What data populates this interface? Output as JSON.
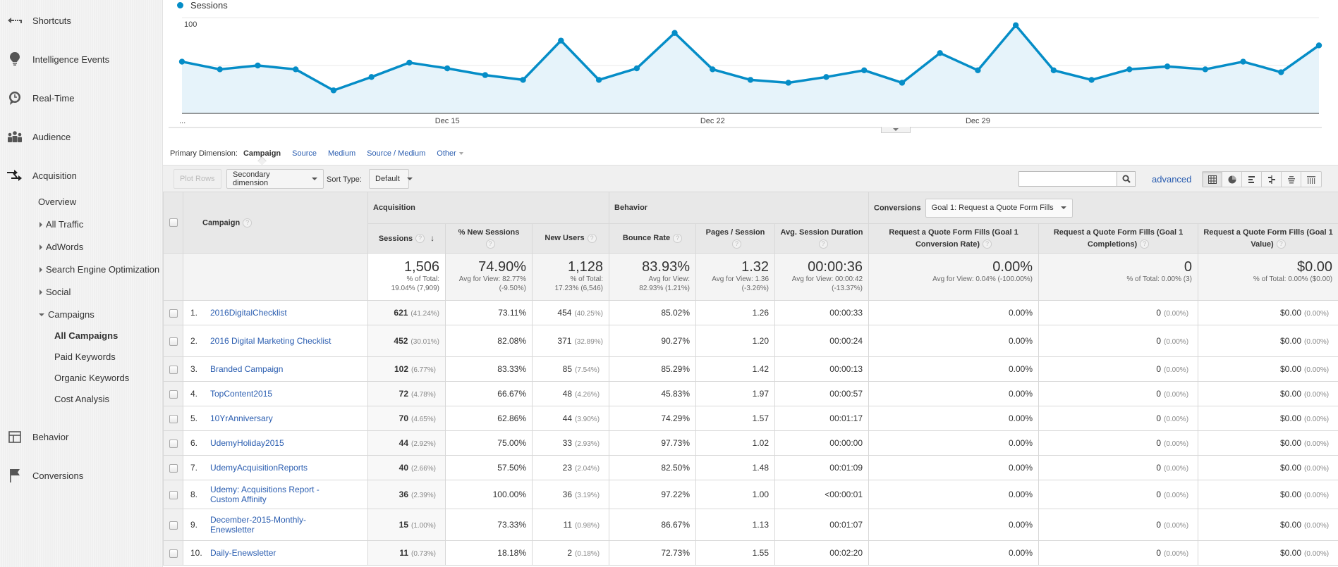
{
  "sidebar": {
    "items": [
      {
        "label": "Shortcuts",
        "icon": "shortcuts-icon"
      },
      {
        "label": "Intelligence Events",
        "icon": "lightbulb-icon"
      },
      {
        "label": "Real-Time",
        "icon": "clock-icon"
      },
      {
        "label": "Audience",
        "icon": "people-icon"
      },
      {
        "label": "Acquisition",
        "icon": "acquisition-arrows-icon"
      },
      {
        "label": "Behavior",
        "icon": "behavior-layout-icon"
      },
      {
        "label": "Conversions",
        "icon": "flag-icon"
      }
    ],
    "acquisition_sub": [
      {
        "label": "Overview"
      },
      {
        "label": "All Traffic",
        "expander": "collapsed"
      },
      {
        "label": "AdWords",
        "expander": "collapsed"
      },
      {
        "label": "Search Engine Optimization",
        "expander": "collapsed"
      },
      {
        "label": "Social",
        "expander": "collapsed"
      },
      {
        "label": "Campaigns",
        "expander": "expanded"
      }
    ],
    "campaigns_sub": [
      {
        "label": "All Campaigns",
        "active": true
      },
      {
        "label": "Paid Keywords"
      },
      {
        "label": "Organic Keywords"
      },
      {
        "label": "Cost Analysis"
      }
    ]
  },
  "chart_data": {
    "type": "area",
    "title": "",
    "series": [
      {
        "name": "Sessions",
        "color": "#058dc7",
        "values": [
          54,
          46,
          50,
          46,
          24,
          38,
          53,
          47,
          40,
          35,
          76,
          35,
          47,
          84,
          46,
          35,
          32,
          38,
          45,
          32,
          63,
          45,
          92,
          45,
          35,
          46,
          49,
          46,
          54,
          43,
          71
        ]
      }
    ],
    "x_tick_labels": [
      {
        "index": 0,
        "label": "..."
      },
      {
        "index": 7,
        "label": "Dec 15"
      },
      {
        "index": 14,
        "label": "Dec 22"
      },
      {
        "index": 21,
        "label": "Dec 29"
      }
    ],
    "y_tick_labels": [
      "100",
      "50"
    ],
    "y_ticks": [
      100,
      50
    ],
    "ylim": [
      0,
      100
    ],
    "grid": true,
    "legend": "top-left",
    "xlabel": "",
    "ylabel": ""
  },
  "primary_dimension": {
    "label": "Primary Dimension:",
    "active": "Campaign",
    "options": [
      "Source",
      "Medium",
      "Source / Medium"
    ],
    "other": "Other"
  },
  "toolbar": {
    "plot_rows": "Plot Rows",
    "secondary_dimension": "Secondary dimension",
    "sort_type_label": "Sort Type:",
    "sort_type_value": "Default",
    "search_value": "",
    "advanced": "advanced"
  },
  "table": {
    "groups": {
      "acquisition": "Acquisition",
      "behavior": "Behavior",
      "conversions": "Conversions",
      "goal_select": "Goal 1: Request a Quote Form Fills"
    },
    "columns": {
      "campaign": "Campaign",
      "sessions": "Sessions",
      "new_sessions": "% New Sessions",
      "new_users": "New Users",
      "bounce_rate": "Bounce Rate",
      "pages_session": "Pages / Session",
      "avg_duration": "Avg. Session Duration",
      "conv_rate": "Request a Quote Form Fills (Goal 1 Conversion Rate)",
      "completions": "Request a Quote Form Fills (Goal 1 Completions)",
      "value": "Request a Quote Form Fills (Goal 1 Value)"
    },
    "totals": {
      "sessions": {
        "value": "1,506",
        "l1": "% of Total:",
        "l2": "19.04% (7,909)"
      },
      "new_sessions": {
        "value": "74.90%",
        "l1": "Avg for View: 82.77%",
        "l2": "(-9.50%)"
      },
      "new_users": {
        "value": "1,128",
        "l1": "% of Total:",
        "l2": "17.23% (6,546)"
      },
      "bounce_rate": {
        "value": "83.93%",
        "l1": "Avg for View:",
        "l2": "82.93% (1.21%)"
      },
      "pages_session": {
        "value": "1.32",
        "l1": "Avg for View: 1.36",
        "l2": "(-3.26%)"
      },
      "avg_duration": {
        "value": "00:00:36",
        "l1": "Avg for View: 00:00:42",
        "l2": "(-13.37%)"
      },
      "conv_rate": {
        "value": "0.00%",
        "l1": "Avg for View: 0.04% (-100.00%)"
      },
      "completions": {
        "value": "0",
        "l1": "% of Total: 0.00% (3)"
      },
      "value": {
        "value": "$0.00",
        "l1": "% of Total: 0.00% ($0.00)"
      }
    },
    "rows": [
      {
        "n": "1.",
        "campaign": "2016DigitalChecklist",
        "sessions": "621",
        "sessions_pct": "(41.24%)",
        "new_sessions": "73.11%",
        "new_users": "454",
        "new_users_pct": "(40.25%)",
        "bounce": "85.02%",
        "pages": "1.26",
        "duration": "00:00:33",
        "conv_rate": "0.00%",
        "completions": "0",
        "completions_pct": "(0.00%)",
        "value": "$0.00",
        "value_pct": "(0.00%)"
      },
      {
        "n": "2.",
        "campaign": "2016 Digital Marketing Checklist",
        "sessions": "452",
        "sessions_pct": "(30.01%)",
        "new_sessions": "82.08%",
        "new_users": "371",
        "new_users_pct": "(32.89%)",
        "bounce": "90.27%",
        "pages": "1.20",
        "duration": "00:00:24",
        "conv_rate": "0.00%",
        "completions": "0",
        "completions_pct": "(0.00%)",
        "value": "$0.00",
        "value_pct": "(0.00%)"
      },
      {
        "n": "3.",
        "campaign": "Branded Campaign",
        "sessions": "102",
        "sessions_pct": "(6.77%)",
        "new_sessions": "83.33%",
        "new_users": "85",
        "new_users_pct": "(7.54%)",
        "bounce": "85.29%",
        "pages": "1.42",
        "duration": "00:00:13",
        "conv_rate": "0.00%",
        "completions": "0",
        "completions_pct": "(0.00%)",
        "value": "$0.00",
        "value_pct": "(0.00%)"
      },
      {
        "n": "4.",
        "campaign": "TopContent2015",
        "sessions": "72",
        "sessions_pct": "(4.78%)",
        "new_sessions": "66.67%",
        "new_users": "48",
        "new_users_pct": "(4.26%)",
        "bounce": "45.83%",
        "pages": "1.97",
        "duration": "00:00:57",
        "conv_rate": "0.00%",
        "completions": "0",
        "completions_pct": "(0.00%)",
        "value": "$0.00",
        "value_pct": "(0.00%)"
      },
      {
        "n": "5.",
        "campaign": "10YrAnniversary",
        "sessions": "70",
        "sessions_pct": "(4.65%)",
        "new_sessions": "62.86%",
        "new_users": "44",
        "new_users_pct": "(3.90%)",
        "bounce": "74.29%",
        "pages": "1.57",
        "duration": "00:01:17",
        "conv_rate": "0.00%",
        "completions": "0",
        "completions_pct": "(0.00%)",
        "value": "$0.00",
        "value_pct": "(0.00%)"
      },
      {
        "n": "6.",
        "campaign": "UdemyHoliday2015",
        "sessions": "44",
        "sessions_pct": "(2.92%)",
        "new_sessions": "75.00%",
        "new_users": "33",
        "new_users_pct": "(2.93%)",
        "bounce": "97.73%",
        "pages": "1.02",
        "duration": "00:00:00",
        "conv_rate": "0.00%",
        "completions": "0",
        "completions_pct": "(0.00%)",
        "value": "$0.00",
        "value_pct": "(0.00%)"
      },
      {
        "n": "7.",
        "campaign": "UdemyAcquisitionReports",
        "sessions": "40",
        "sessions_pct": "(2.66%)",
        "new_sessions": "57.50%",
        "new_users": "23",
        "new_users_pct": "(2.04%)",
        "bounce": "82.50%",
        "pages": "1.48",
        "duration": "00:01:09",
        "conv_rate": "0.00%",
        "completions": "0",
        "completions_pct": "(0.00%)",
        "value": "$0.00",
        "value_pct": "(0.00%)"
      },
      {
        "n": "8.",
        "campaign": "Udemy: Acquisitions Report - Custom Affinity",
        "sessions": "36",
        "sessions_pct": "(2.39%)",
        "new_sessions": "100.00%",
        "new_users": "36",
        "new_users_pct": "(3.19%)",
        "bounce": "97.22%",
        "pages": "1.00",
        "duration": "<00:00:01",
        "conv_rate": "0.00%",
        "completions": "0",
        "completions_pct": "(0.00%)",
        "value": "$0.00",
        "value_pct": "(0.00%)"
      },
      {
        "n": "9.",
        "campaign": "December-2015-Monthly-Enewsletter",
        "sessions": "15",
        "sessions_pct": "(1.00%)",
        "new_sessions": "73.33%",
        "new_users": "11",
        "new_users_pct": "(0.98%)",
        "bounce": "86.67%",
        "pages": "1.13",
        "duration": "00:01:07",
        "conv_rate": "0.00%",
        "completions": "0",
        "completions_pct": "(0.00%)",
        "value": "$0.00",
        "value_pct": "(0.00%)"
      },
      {
        "n": "10.",
        "campaign": "Daily-Enewsletter",
        "sessions": "11",
        "sessions_pct": "(0.73%)",
        "new_sessions": "18.18%",
        "new_users": "2",
        "new_users_pct": "(0.18%)",
        "bounce": "72.73%",
        "pages": "1.55",
        "duration": "00:02:20",
        "conv_rate": "0.00%",
        "completions": "0",
        "completions_pct": "(0.00%)",
        "value": "$0.00",
        "value_pct": "(0.00%)"
      }
    ]
  }
}
